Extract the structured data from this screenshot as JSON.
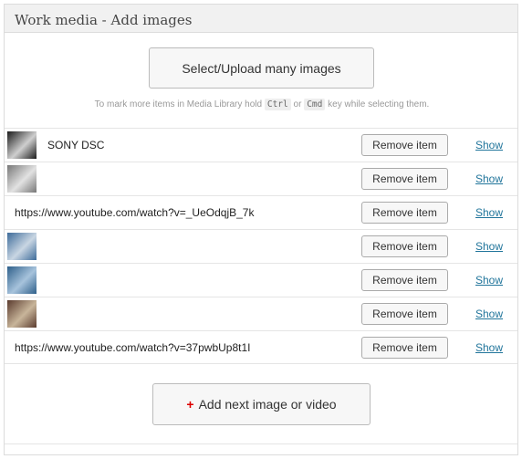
{
  "panel": {
    "title": "Work media - Add images"
  },
  "upload": {
    "label": "Select/Upload many images"
  },
  "hint": {
    "prefix": "To mark more items in Media Library hold",
    "key1": "Ctrl",
    "or": "or",
    "key2": "Cmd",
    "suffix": "key while selecting them."
  },
  "items": [
    {
      "type": "image",
      "caption": "SONY DSC",
      "remove_label": "Remove item",
      "show_label": "Show",
      "thumb_colors": [
        "#1a1a1a",
        "#cfcfcf"
      ]
    },
    {
      "type": "image",
      "caption": "",
      "remove_label": "Remove item",
      "show_label": "Show",
      "thumb_colors": [
        "#777777",
        "#e2e2e2"
      ]
    },
    {
      "type": "video",
      "caption": "https://www.youtube.com/watch?v=_UeOdqjB_7k",
      "remove_label": "Remove item",
      "show_label": "Show"
    },
    {
      "type": "image",
      "caption": "",
      "remove_label": "Remove item",
      "show_label": "Show",
      "thumb_colors": [
        "#3d6b9a",
        "#c9d6e3"
      ]
    },
    {
      "type": "image",
      "caption": "",
      "remove_label": "Remove item",
      "show_label": "Show",
      "thumb_colors": [
        "#2e5f8a",
        "#a7c3dc"
      ]
    },
    {
      "type": "image",
      "caption": "",
      "remove_label": "Remove item",
      "show_label": "Show",
      "thumb_colors": [
        "#5a3b2e",
        "#c8b59a"
      ]
    },
    {
      "type": "video",
      "caption": "https://www.youtube.com/watch?v=37pwbUp8t1I",
      "remove_label": "Remove item",
      "show_label": "Show"
    }
  ],
  "add": {
    "plus": "+",
    "label": "Add next image or video"
  }
}
